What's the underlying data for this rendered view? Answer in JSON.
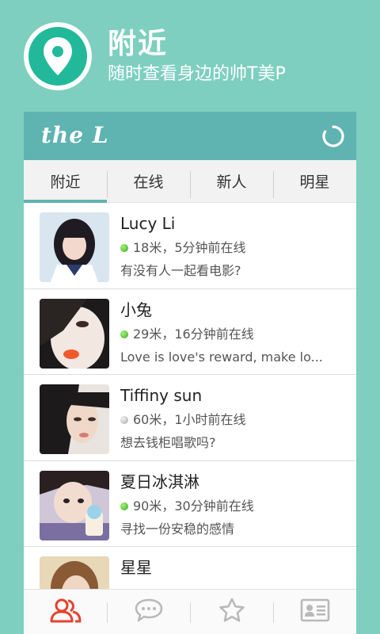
{
  "promo": {
    "title": "附近",
    "subtitle": "随时查看身边的帅T美P",
    "icon": "location-pin-icon"
  },
  "app": {
    "logo": "the L",
    "refresh_icon": "refresh-icon",
    "accent_color": "#5fb3b1",
    "tabs": [
      {
        "label": "附近",
        "active": true
      },
      {
        "label": "在线",
        "active": false
      },
      {
        "label": "新人",
        "active": false
      },
      {
        "label": "明星",
        "active": false
      }
    ],
    "users": [
      {
        "name": "Lucy Li",
        "online": true,
        "status": "18米，5分钟前在线",
        "signature": "有没有人一起看电影?"
      },
      {
        "name": "小兔",
        "online": true,
        "status": "29米，16分钟前在线",
        "signature": "Love is love's  reward, make lo..."
      },
      {
        "name": "Tiffiny sun",
        "online": false,
        "status": "60米，1小时前在线",
        "signature": "想去钱柜唱歌吗?"
      },
      {
        "name": "夏日冰淇淋",
        "online": true,
        "status": "90米，30分钟前在线",
        "signature": "寻找一份安稳的感情"
      },
      {
        "name": "星星",
        "online": true,
        "status": "",
        "signature": ""
      }
    ],
    "bottom_nav": [
      {
        "icon": "people-icon",
        "active": true
      },
      {
        "icon": "chat-bubble-icon",
        "active": false
      },
      {
        "icon": "star-icon",
        "active": false
      },
      {
        "icon": "contact-card-icon",
        "active": false
      }
    ]
  }
}
